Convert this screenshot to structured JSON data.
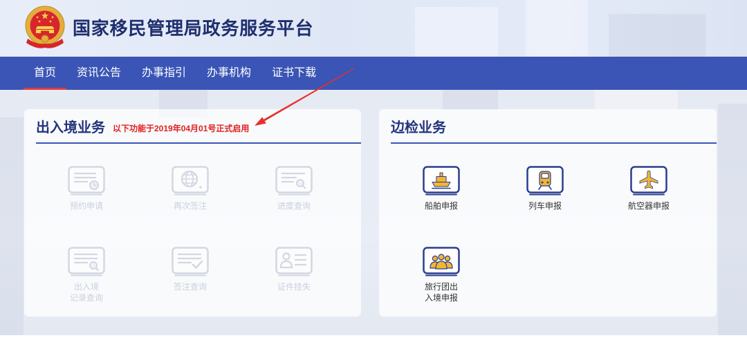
{
  "header": {
    "logo_icon": "national-emblem-icon",
    "title": "国家移民管理局政务服务平台"
  },
  "nav": {
    "items": [
      {
        "label": "首页",
        "active": true
      },
      {
        "label": "资讯公告",
        "active": false
      },
      {
        "label": "办事指引",
        "active": false
      },
      {
        "label": "办事机构",
        "active": false
      },
      {
        "label": "证书下载",
        "active": false
      }
    ]
  },
  "cards": [
    {
      "title": "出入境业务",
      "note": "以下功能于2019年04月01号正式启用",
      "disabled": true,
      "items": [
        {
          "lines": [
            "预约申请"
          ],
          "icon": "document-clock-icon"
        },
        {
          "lines": [
            "再次签注"
          ],
          "icon": "globe-document-icon"
        },
        {
          "lines": [
            "进度查询"
          ],
          "icon": "document-search-icon"
        },
        {
          "lines": [
            "出入境",
            "记录查询"
          ],
          "icon": "record-search-icon"
        },
        {
          "lines": [
            "签注查询"
          ],
          "icon": "document-check-icon"
        },
        {
          "lines": [
            "证件挂失"
          ],
          "icon": "id-card-icon"
        }
      ]
    },
    {
      "title": "边检业务",
      "disabled": false,
      "items": [
        {
          "lines": [
            "船舶申报"
          ],
          "icon": "ship-icon"
        },
        {
          "lines": [
            "列车申报"
          ],
          "icon": "train-icon"
        },
        {
          "lines": [
            "航空器申报"
          ],
          "icon": "airplane-icon"
        },
        {
          "lines": [
            "旅行团出",
            "入境申报"
          ],
          "icon": "tour-group-icon"
        }
      ]
    }
  ],
  "colors": {
    "nav_bg": "#3a55b5",
    "nav_active_underline": "#e43c3c",
    "title_text": "#1f2e6d",
    "note_red": "#e11f1f",
    "icon_outline": "#2b3d8f",
    "icon_accent": "#f2b632",
    "disabled_gray": "#d2d7e1",
    "annotation_arrow": "#e8302e"
  }
}
